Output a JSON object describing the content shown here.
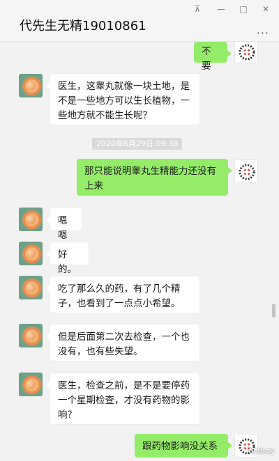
{
  "window": {
    "title": "代先生无精19010861",
    "controls": {
      "pin": "⊼",
      "minimize": "—",
      "maximize": "□",
      "close": "✕"
    },
    "menu_icon": "more-dots-icon"
  },
  "chat": {
    "timestamp": "2020年6月29日 09:38",
    "messages": [
      {
        "side": "right",
        "text": "不要"
      },
      {
        "side": "left",
        "text": "医生，这睾丸就像一块土地，是不是一些地方可以生长植物，一些地方就不能生长呢？"
      },
      {
        "side": "right",
        "text": "那只能说明睾丸生精能力还没有上来"
      },
      {
        "side": "left",
        "text": "嗯嗯"
      },
      {
        "side": "left",
        "text": "好的。"
      },
      {
        "side": "left",
        "text": "吃了那么久的药，有了几个精子，也看到了一点点小希望。"
      },
      {
        "side": "left",
        "text": "但是后面第二次去检查，一个也没有，也有些失望。"
      },
      {
        "side": "left",
        "text": "医生，检查之前，是不是要停药一个星期检查，才没有药物的影响？"
      },
      {
        "side": "right",
        "text": "跟药物影响没关系"
      }
    ]
  },
  "watermark": "jdzdszy",
  "colors": {
    "sent_bubble": "#95ec69",
    "received_bubble": "#ffffff",
    "background": "#f2f2f2"
  }
}
